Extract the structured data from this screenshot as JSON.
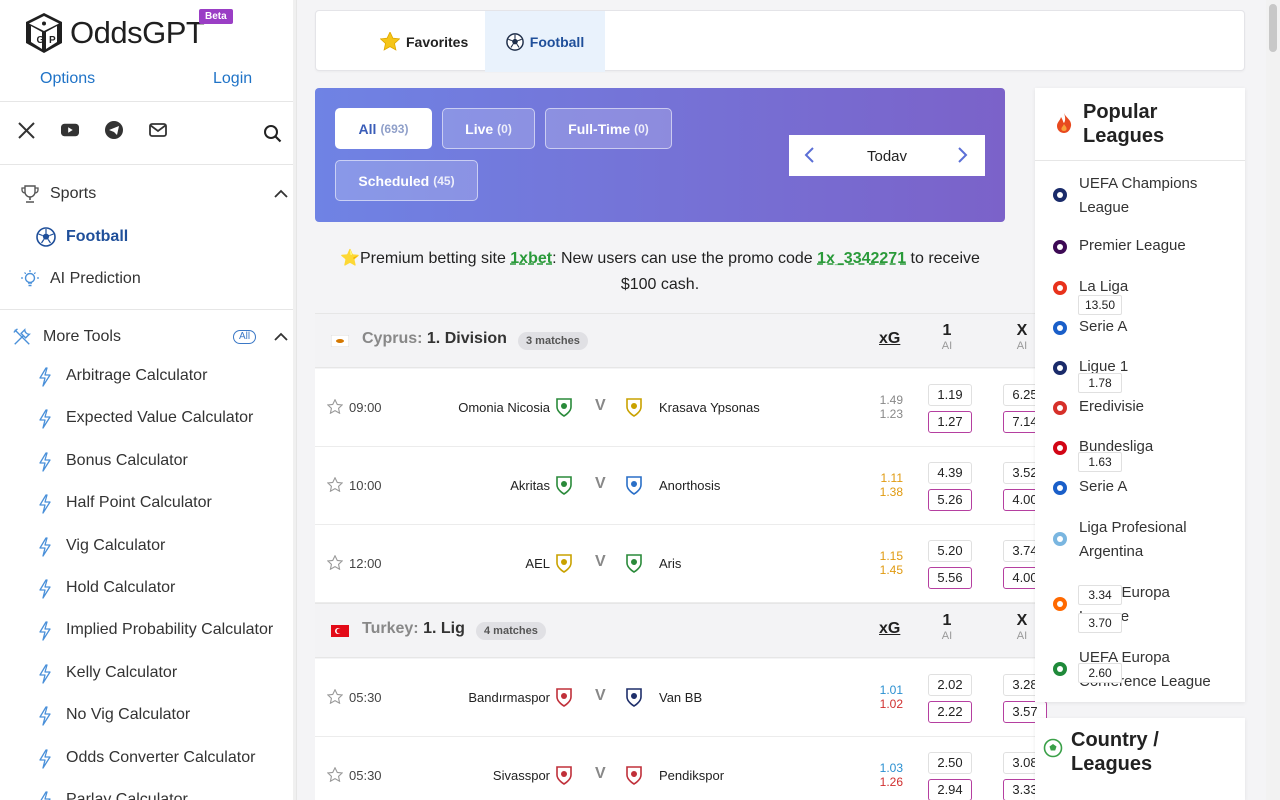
{
  "brand": {
    "name": "OddsGPT",
    "badge": "Beta"
  },
  "top_links": {
    "options": "Options",
    "login": "Login"
  },
  "social_icons": [
    "x-icon",
    "youtube-icon",
    "telegram-icon",
    "mail-icon"
  ],
  "nav": {
    "sports": "Sports",
    "football": "Football",
    "ai_prediction": "AI Prediction",
    "more_tools": "More Tools",
    "all_badge": "All"
  },
  "tools": [
    "Arbitrage Calculator",
    "Expected Value Calculator",
    "Bonus Calculator",
    "Half Point Calculator",
    "Vig Calculator",
    "Hold Calculator",
    "Implied Probability Calculator",
    "Kelly Calculator",
    "No Vig Calculator",
    "Odds Converter Calculator",
    "Parlay Calculator"
  ],
  "tabs": {
    "favorites": "Favorites",
    "football": "Football"
  },
  "filters": {
    "all": {
      "label": "All",
      "count": "(693)"
    },
    "live": {
      "label": "Live",
      "count": "(0)"
    },
    "fulltime": {
      "label": "Full-Time",
      "count": "(0)"
    },
    "scheduled": {
      "label": "Scheduled",
      "count": "(45)"
    }
  },
  "date_label": "Todav",
  "promo": {
    "prefix": "⭐Premium betting site ",
    "site": "1xbet",
    "middle": ": New users can use the promo code ",
    "code": "1x_3342271",
    "suffix": " to receive",
    "line2": "$100 cash."
  },
  "leagues": [
    {
      "country": "Cyprus:",
      "name": "1. Division",
      "count": "3 matches",
      "xg_label": "xG",
      "col1": "1",
      "colx": "X",
      "ai": "AI",
      "matches": [
        {
          "time": "09:00",
          "home": "Omonia Nicosia",
          "away": "Krasava Ypsonas",
          "xg_home": "1.49",
          "xg_away": "1.23",
          "xg_color_home": "#888888",
          "xg_color_away": "#888888",
          "o1_top": "1.19",
          "o1_bot": "1.27",
          "ox_top": "6.25",
          "ox_bot": "7.14"
        },
        {
          "time": "10:00",
          "home": "Akritas",
          "away": "Anorthosis",
          "xg_home": "1.11",
          "xg_away": "1.38",
          "xg_color_home": "#e09a10",
          "xg_color_away": "#e09a10",
          "o1_top": "4.39",
          "o1_bot": "5.26",
          "ox_top": "3.52",
          "ox_bot": "4.00"
        },
        {
          "time": "12:00",
          "home": "AEL",
          "away": "Aris",
          "xg_home": "1.15",
          "xg_away": "1.45",
          "xg_color_home": "#e09a10",
          "xg_color_away": "#e09a10",
          "o1_top": "5.20",
          "o1_bot": "5.56",
          "ox_top": "3.74",
          "ox_bot": "4.00"
        }
      ]
    },
    {
      "country": "Turkey:",
      "name": "1. Lig",
      "count": "4 matches",
      "xg_label": "xG",
      "col1": "1",
      "colx": "X",
      "ai": "AI",
      "matches": [
        {
          "time": "05:30",
          "home": "Bandırmaspor",
          "away": "Van BB",
          "xg_home": "1.01",
          "xg_away": "1.02",
          "xg_color_home": "#2a8fd0",
          "xg_color_away": "#d03030",
          "o1_top": "2.02",
          "o1_bot": "2.22",
          "ox_top": "3.28",
          "ox_bot": "3.57"
        },
        {
          "time": "05:30",
          "home": "Sivasspor",
          "away": "Pendikspor",
          "xg_home": "1.03",
          "xg_away": "1.26",
          "xg_color_home": "#2a8fd0",
          "xg_color_away": "#d03030",
          "o1_top": "2.50",
          "o1_bot": "2.94",
          "ox_top": "3.08",
          "ox_bot": "3.33"
        }
      ]
    }
  ],
  "popular": {
    "title_line1": "Popular",
    "title_line2": "Leagues",
    "items": [
      {
        "line1": "UEFA Champions",
        "line2": "League"
      },
      {
        "line1": "Premier League",
        "line2": ""
      },
      {
        "line1": "La Liga",
        "line2": ""
      },
      {
        "line1": "Serie A",
        "line2": ""
      },
      {
        "line1": "Ligue 1",
        "line2": ""
      },
      {
        "line1": "Eredivisie",
        "line2": ""
      },
      {
        "line1": "Bundesliga",
        "line2": ""
      },
      {
        "line1": "Serie A",
        "line2": ""
      },
      {
        "line1": "Liga Profesional",
        "line2": "Argentina"
      },
      {
        "line1": "UEFA Europa",
        "line2": "League"
      },
      {
        "line1": "UEFA Europa",
        "line2": "Conference League"
      }
    ],
    "overlay_odds": [
      "13.50",
      "1.78",
      "1.63",
      "3.34",
      "3.70",
      "2.60"
    ]
  },
  "country_leagues": {
    "line1": "Country /",
    "line2": "Leagues"
  }
}
